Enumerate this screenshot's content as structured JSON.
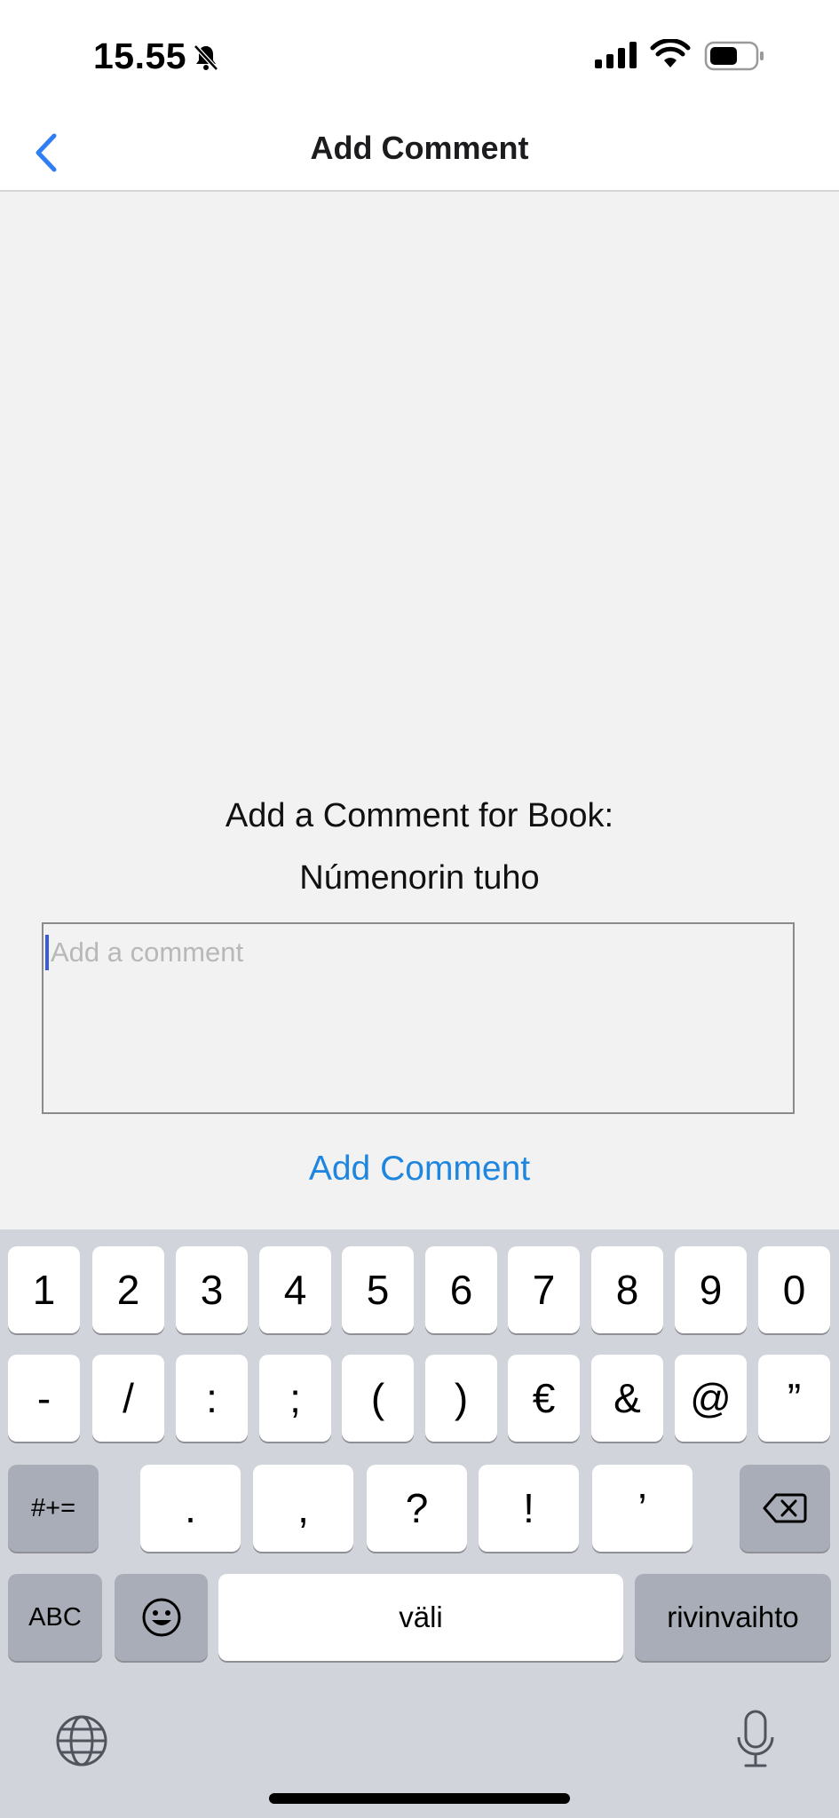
{
  "status": {
    "time": "15.55"
  },
  "nav": {
    "title": "Add Comment"
  },
  "content": {
    "prompt": "Add a Comment for Book:",
    "book_title": "Númenorin tuho",
    "comment_placeholder": "Add a comment",
    "add_button": "Add Comment"
  },
  "keyboard": {
    "row1": [
      "1",
      "2",
      "3",
      "4",
      "5",
      "6",
      "7",
      "8",
      "9",
      "0"
    ],
    "row2": [
      "-",
      "/",
      ":",
      ";",
      "(",
      ")",
      "€",
      "&",
      "@",
      "”"
    ],
    "row3": [
      ".",
      ",",
      "?",
      "!",
      "’"
    ],
    "shift_label": "#+=",
    "abc_label": "ABC",
    "space_label": "väli",
    "return_label": "rivinvaihto"
  },
  "colors": {
    "accent": "#1f86e0",
    "back": "#2f7ef5"
  }
}
